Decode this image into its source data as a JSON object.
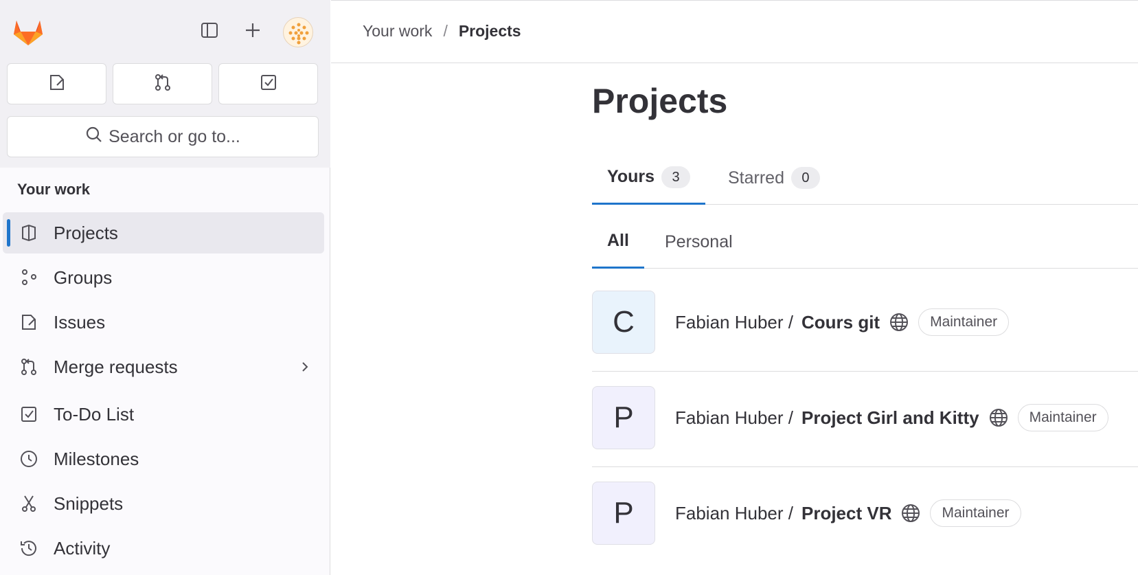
{
  "sidebar": {
    "search_placeholder": "Search or go to...",
    "section_title": "Your work",
    "items": [
      {
        "label": "Projects",
        "icon": "project-icon",
        "active": true
      },
      {
        "label": "Groups",
        "icon": "group-icon"
      },
      {
        "label": "Issues",
        "icon": "issues-icon"
      },
      {
        "label": "Merge requests",
        "icon": "merge-request-icon",
        "has_chevron": true
      },
      {
        "label": "To-Do List",
        "icon": "todo-icon"
      },
      {
        "label": "Milestones",
        "icon": "clock-icon"
      },
      {
        "label": "Snippets",
        "icon": "snippet-icon"
      },
      {
        "label": "Activity",
        "icon": "history-icon"
      }
    ]
  },
  "header": {
    "breadcrumb": [
      "Your work",
      "Projects"
    ],
    "separator": "/"
  },
  "main": {
    "title": "Projects",
    "tabs": [
      {
        "label": "Yours",
        "count": "3",
        "active": true
      },
      {
        "label": "Starred",
        "count": "0"
      }
    ],
    "subtabs": [
      {
        "label": "All",
        "active": true
      },
      {
        "label": "Personal"
      }
    ],
    "projects": [
      {
        "initial": "C",
        "namespace": "Fabian Huber /",
        "name": "Cours git",
        "visibility_icon": "globe-icon",
        "role": "Maintainer",
        "avatar_color": "#e9f3fc"
      },
      {
        "initial": "P",
        "namespace": "Fabian Huber /",
        "name": "Project Girl and Kitty",
        "visibility_icon": "globe-icon",
        "role": "Maintainer",
        "avatar_color": "#f1f0fd"
      },
      {
        "initial": "P",
        "namespace": "Fabian Huber /",
        "name": "Project VR",
        "visibility_icon": "globe-icon",
        "role": "Maintainer",
        "avatar_color": "#f1f0fd"
      }
    ]
  },
  "colors": {
    "accent": "#1f75cb",
    "logo_orange": "#fc6d26",
    "logo_red": "#e24329",
    "logo_yellow": "#fca326"
  }
}
